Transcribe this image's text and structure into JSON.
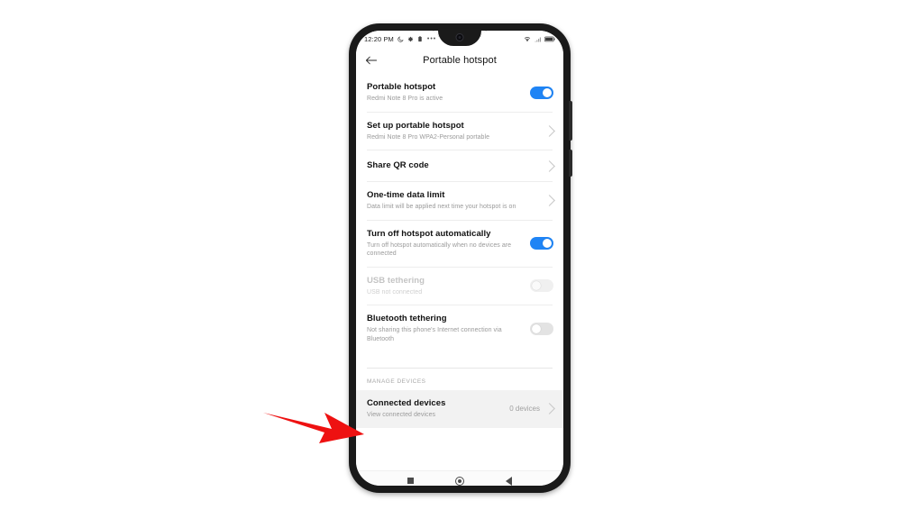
{
  "statusbar": {
    "time": "12:20 PM",
    "left_icons": [
      "moon-icon",
      "gear-icon",
      "battery-saver-icon",
      "overflow-dots-icon"
    ],
    "right_icons": [
      "wifi-icon",
      "signal-icon",
      "battery-icon"
    ]
  },
  "appbar": {
    "back_icon": "back-arrow-icon",
    "title": "Portable hotspot"
  },
  "rows": [
    {
      "name": "portable-hotspot",
      "title": "Portable hotspot",
      "subtitle": "Redmi Note 8 Pro is active",
      "control": "switch",
      "switch_on": true,
      "disabled": false
    },
    {
      "name": "set-up-portable-hotspot",
      "title": "Set up portable hotspot",
      "subtitle": "Redmi Note 8 Pro WPA2-Personal portable",
      "control": "chevron",
      "disabled": false
    },
    {
      "name": "share-qr-code",
      "title": "Share QR code",
      "subtitle": "",
      "control": "chevron",
      "disabled": false
    },
    {
      "name": "one-time-data-limit",
      "title": "One-time data limit",
      "subtitle": "Data limit will be applied next time your hotspot is on",
      "control": "chevron",
      "disabled": false
    },
    {
      "name": "turn-off-hotspot-automatically",
      "title": "Turn off hotspot automatically",
      "subtitle": "Turn off hotspot automatically when no devices are connected",
      "control": "switch",
      "switch_on": true,
      "disabled": false
    },
    {
      "name": "usb-tethering",
      "title": "USB tethering",
      "subtitle": "USB not connected",
      "control": "switch",
      "switch_on": false,
      "disabled": true
    },
    {
      "name": "bluetooth-tethering",
      "title": "Bluetooth tethering",
      "subtitle": "Not sharing this phone's Internet connection via Bluetooth",
      "control": "switch",
      "switch_on": false,
      "disabled": false
    }
  ],
  "manage_devices": {
    "section_label": "MANAGE DEVICES",
    "connected_devices": {
      "title": "Connected devices",
      "subtitle": "View connected devices",
      "value": "0 devices"
    }
  },
  "navbar": {
    "recents_label": "recents-square-icon",
    "home_label": "home-circle-icon",
    "back_label": "back-triangle-icon"
  },
  "annotation": {
    "arrow_color": "#ee1111",
    "arrow_name": "red-pointer-arrow"
  },
  "colors": {
    "accent_on": "#1f84f5",
    "switch_off": "#e3e3e3",
    "title_text": "#111111",
    "sub_text": "#9a9a9a",
    "disabled_text": "#c4c4c4",
    "highlight_row": "#f2f2f2",
    "frame": "#1a1a1a"
  }
}
